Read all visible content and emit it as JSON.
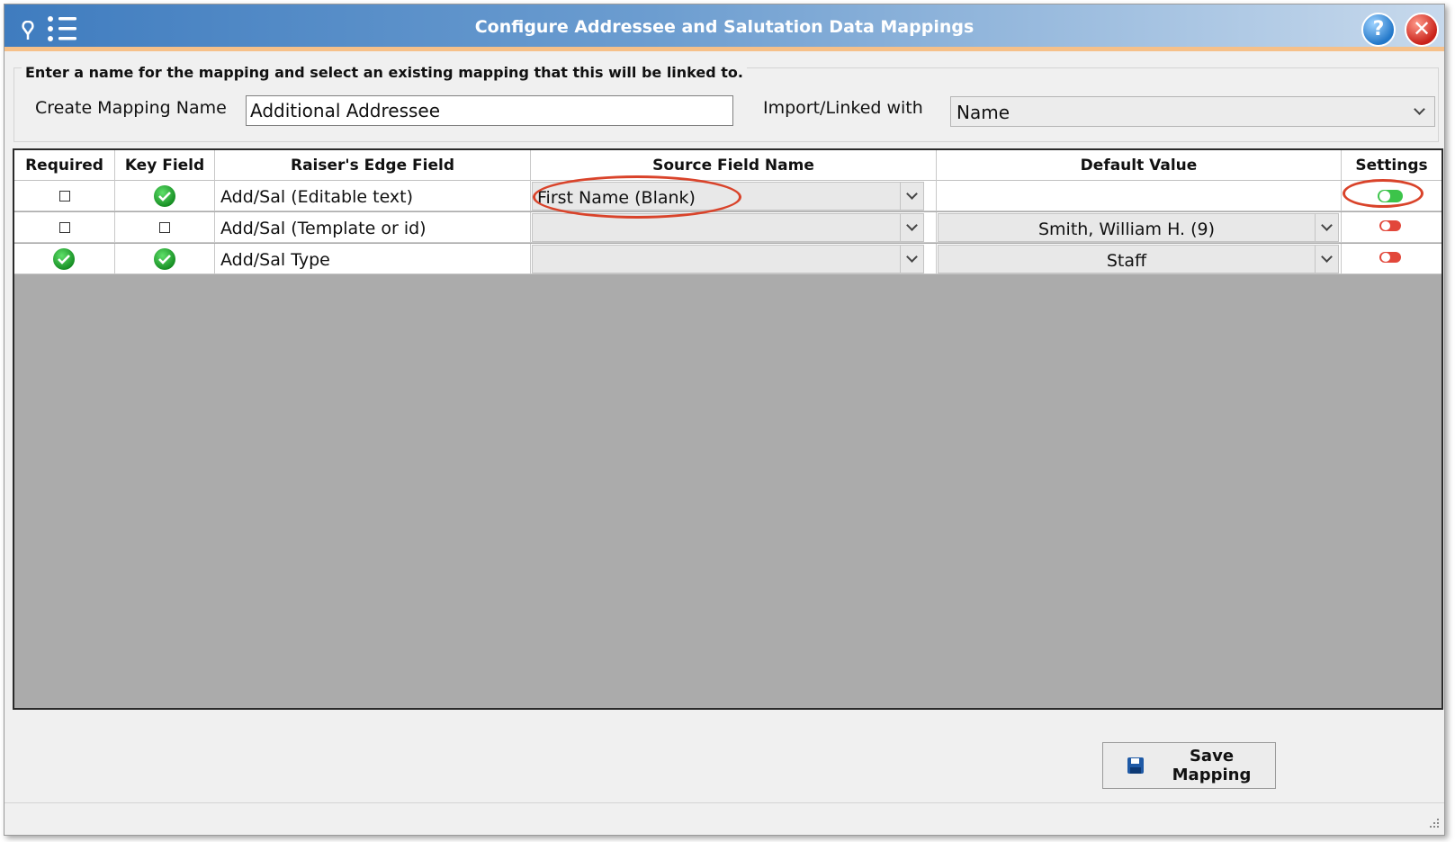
{
  "window": {
    "title": "Configure Addressee and Salutation Data Mappings",
    "help_glyph": "?",
    "close_glyph": "✕"
  },
  "form": {
    "instructions": "Enter a name for the mapping and select an existing mapping that this will be linked to.",
    "mapping_name_label": "Create Mapping Name",
    "mapping_name_value": "Additional Addressee",
    "import_label": "Import/Linked with",
    "import_value": "Name"
  },
  "grid": {
    "headers": [
      "Required",
      "Key Field",
      "Raiser's Edge Field",
      "Source Field Name",
      "Default Value",
      "Settings"
    ],
    "rows": [
      {
        "required": false,
        "key_field": true,
        "field": "Add/Sal (Editable text)",
        "source": "First Name (Blank)",
        "default": "",
        "default_is_dropdown": false,
        "setting_on": true
      },
      {
        "required": false,
        "key_field": false,
        "field": "Add/Sal (Template or id)",
        "source": "",
        "default": "Smith, William H. (9)",
        "default_is_dropdown": true,
        "setting_on": false
      },
      {
        "required": true,
        "key_field": true,
        "field": "Add/Sal Type",
        "source": "",
        "default": "Staff",
        "default_is_dropdown": true,
        "setting_on": false
      }
    ]
  },
  "footer": {
    "save_label_line1": "Save",
    "save_label_line2": "Mapping"
  },
  "colors": {
    "titlebar_start": "#3f7cbf",
    "accent_orange": "#f6c089",
    "toggle_on": "#3cc44a",
    "toggle_off": "#e2473a",
    "annotation_red": "#d9432a",
    "grid_empty": "#ababab"
  },
  "icons": [
    "pin-icon",
    "list-icon",
    "help-icon",
    "close-icon",
    "check-icon",
    "checkbox-icon",
    "chevron-down-icon",
    "toggle-icon",
    "floppy-disk-icon",
    "resize-grip-icon"
  ]
}
